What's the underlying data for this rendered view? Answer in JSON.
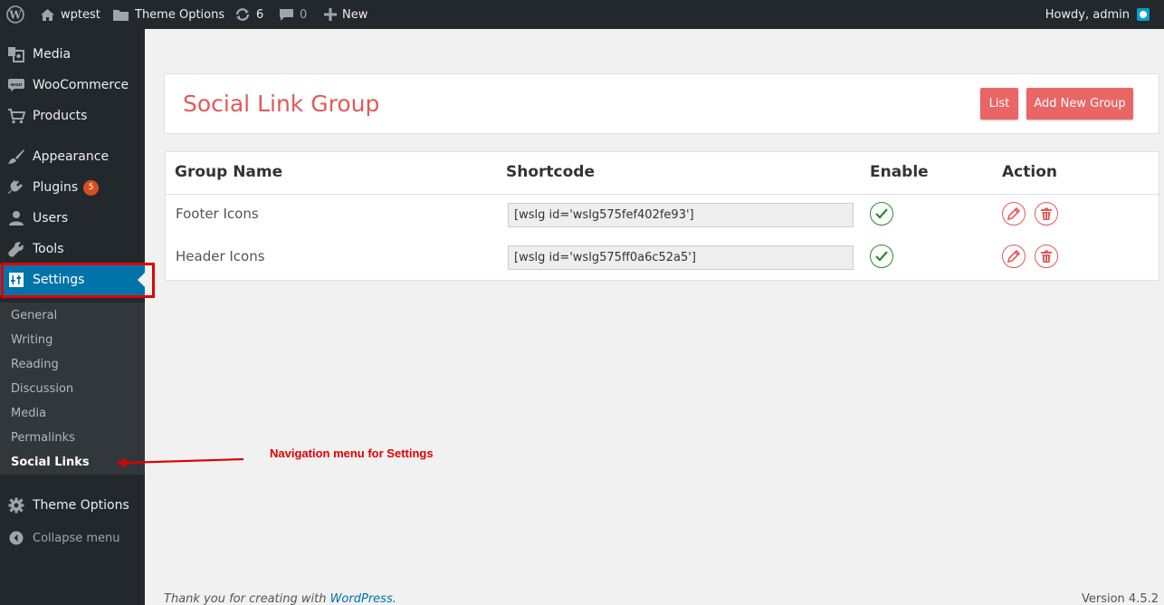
{
  "adminbar": {
    "site_name": "wptest",
    "theme_options": "Theme Options",
    "updates_count": "6",
    "comments_count": "0",
    "new_label": "New",
    "howdy": "Howdy, admin"
  },
  "sidebar": {
    "items": [
      {
        "label": "Media",
        "icon": "media-icon"
      },
      {
        "label": "WooCommerce",
        "icon": "woocommerce-icon"
      },
      {
        "label": "Products",
        "icon": "cart-icon"
      },
      {
        "label": "Appearance",
        "icon": "brush-icon"
      },
      {
        "label": "Plugins",
        "icon": "plug-icon",
        "badge": "5"
      },
      {
        "label": "Users",
        "icon": "user-icon"
      },
      {
        "label": "Tools",
        "icon": "wrench-icon"
      },
      {
        "label": "Settings",
        "icon": "settings-icon"
      },
      {
        "label": "Theme Options",
        "icon": "gear-icon"
      }
    ],
    "submenu": [
      "General",
      "Writing",
      "Reading",
      "Discussion",
      "Media",
      "Permalinks",
      "Social Links"
    ],
    "collapse_label": "Collapse menu"
  },
  "page": {
    "title": "Social Link Group",
    "list_button": "List",
    "add_button": "Add New Group"
  },
  "table": {
    "headers": [
      "Group Name",
      "Shortcode",
      "Enable",
      "Action"
    ],
    "rows": [
      {
        "name": "Footer Icons",
        "shortcode": "[wslg id='wslg575fef402fe93']"
      },
      {
        "name": "Header Icons",
        "shortcode": "[wslg id='wslg575ff0a6c52a5']"
      }
    ]
  },
  "annotation": {
    "text": "Navigation menu for Settings"
  },
  "footer": {
    "thanks_prefix": "Thank you for creating with ",
    "thanks_link": "WordPress",
    "thanks_suffix": ".",
    "version": "Version 4.5.2"
  },
  "colors": {
    "adminbar_bg": "#23282d",
    "current_menu": "#0073aa",
    "accent": "#ea6565",
    "enabled": "#2a8a2a",
    "annotation": "#e00000"
  }
}
